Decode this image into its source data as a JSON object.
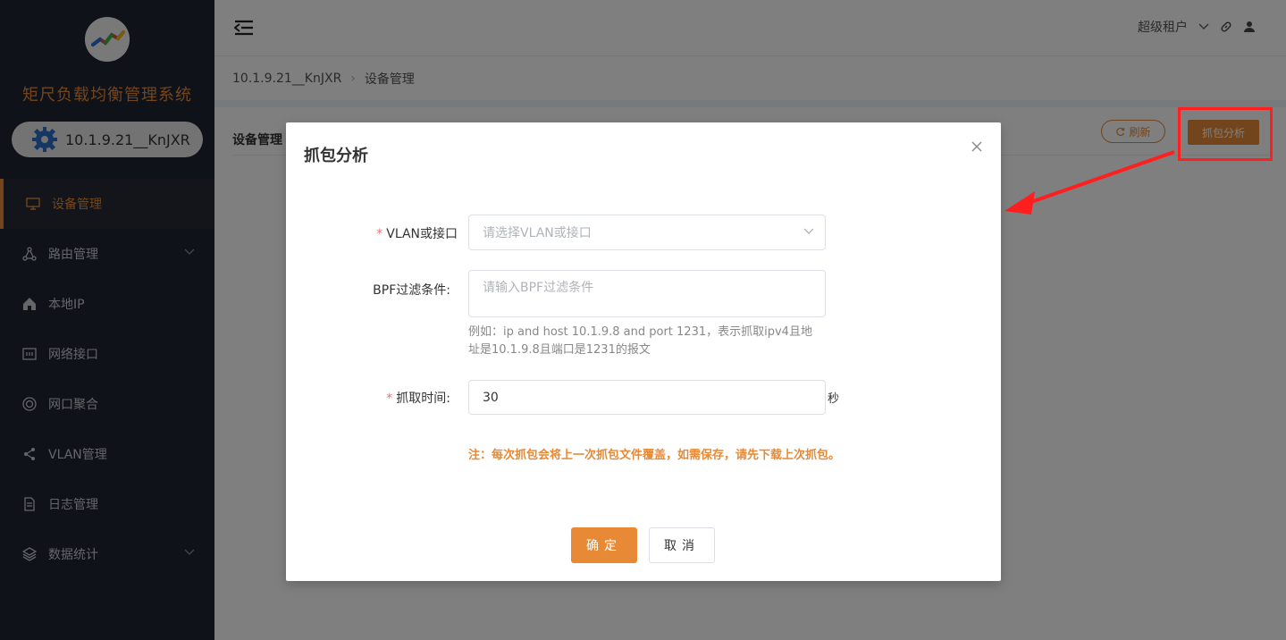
{
  "app": {
    "title": "矩尺负载均衡管理系统",
    "tenant": "10.1.9.21__KnJXR"
  },
  "sidebar": {
    "items": [
      {
        "label": "设备管理",
        "icon": "monitor-icon",
        "active": true
      },
      {
        "label": "路由管理",
        "icon": "route-icon",
        "has_submenu": true
      },
      {
        "label": "本地IP",
        "icon": "home-icon"
      },
      {
        "label": "网络接口",
        "icon": "interface-icon"
      },
      {
        "label": "网口聚合",
        "icon": "aggregate-icon"
      },
      {
        "label": "VLAN管理",
        "icon": "share-icon"
      },
      {
        "label": "日志管理",
        "icon": "document-icon"
      },
      {
        "label": "数据统计",
        "icon": "layers-icon",
        "has_submenu": true
      }
    ]
  },
  "header": {
    "user_label": "超级租户"
  },
  "breadcrumb": {
    "root": "10.1.9.21__KnJXR",
    "current": "设备管理"
  },
  "content": {
    "title": "设备管理",
    "refresh_label": "刷新",
    "capture_label": "抓包分析"
  },
  "modal": {
    "title": "抓包分析",
    "vlan_label": "VLAN或接口",
    "vlan_placeholder": "请选择VLAN或接口",
    "bpf_label": "BPF过滤条件:",
    "bpf_placeholder": "请输入BPF过滤条件",
    "bpf_help_line1": "例如：ip and host 10.1.9.8 and port 1231，表示抓取ipv4且地",
    "bpf_help_line2": "址是10.1.9.8且端口是1231的报文",
    "time_label": "抓取时间:",
    "time_value": "30",
    "time_unit": "秒",
    "note": "注：每次抓包会将上一次抓包文件覆盖，如需保存，请先下载上次抓包。",
    "ok_label": "确定",
    "cancel_label": "取消"
  },
  "colors": {
    "accent": "#e58a39",
    "sidebar_bg": "#1f2430",
    "highlight": "#ff1f1f"
  }
}
